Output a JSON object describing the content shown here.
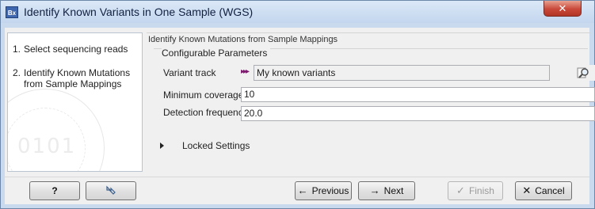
{
  "window": {
    "title": "Identify Known Variants in One Sample (WGS)",
    "app_icon": "Bx",
    "close_glyph": "✕"
  },
  "steps": [
    {
      "num": "1.",
      "label": "Select sequencing reads"
    },
    {
      "num": "2.",
      "label": "Identify Known Mutations",
      "label2": "from Sample Mappings"
    }
  ],
  "section": {
    "title": "Identify Known Mutations from Sample Mappings",
    "group_title": "Configurable Parameters"
  },
  "fields": {
    "variant_track_label": "Variant track",
    "variant_track_value": "My known variants",
    "min_coverage_label": "Minimum coverage",
    "min_coverage_value": "10",
    "detection_freq_label": "Detection frequency",
    "detection_freq_value": "20.0"
  },
  "locked": {
    "label": "Locked Settings"
  },
  "buttons": {
    "help": "?",
    "previous": "Previous",
    "next": "Next",
    "finish": "Finish",
    "cancel": "Cancel"
  },
  "icons": {
    "track": "track-icon",
    "browse": "browse-icon",
    "reset": "reset-icon",
    "prev_arrow": "←",
    "next_arrow": "→",
    "finish_check": "✓",
    "cancel_x": "✕"
  },
  "colors": {
    "title_bar": "#c9daee",
    "close_button": "#c9483a",
    "track_icon": "#7d1a6e"
  }
}
